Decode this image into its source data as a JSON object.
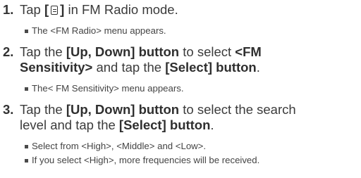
{
  "steps": [
    {
      "number": "1.",
      "line1": {
        "pre": "Tap ",
        "icon_open": "[",
        "icon": "menu-icon",
        "icon_close": "]",
        "post": " in FM Radio mode."
      },
      "notes": [
        "The <FM Radio> menu appears."
      ]
    },
    {
      "number": "2.",
      "line1": {
        "a": "Tap the ",
        "b_bold": "[Up, Down] button",
        "c": " to select ",
        "d_bold": "<FM"
      },
      "line2": {
        "a_bold": "Sensitivity>",
        "b": " and tap the ",
        "c_bold": "[Select] button",
        "d": "."
      },
      "notes": [
        "The< FM Sensitivity> menu appears."
      ]
    },
    {
      "number": "3.",
      "line1": {
        "a": "Tap the ",
        "b_bold": "[Up, Down] button",
        "c": " to select the search"
      },
      "line2": {
        "a": "level and tap the ",
        "b_bold": "[Select] button",
        "c": "."
      },
      "notes": [
        "Select from <High>, <Middle> and <Low>.",
        "If you select <High>, more frequencies will be received."
      ]
    }
  ]
}
